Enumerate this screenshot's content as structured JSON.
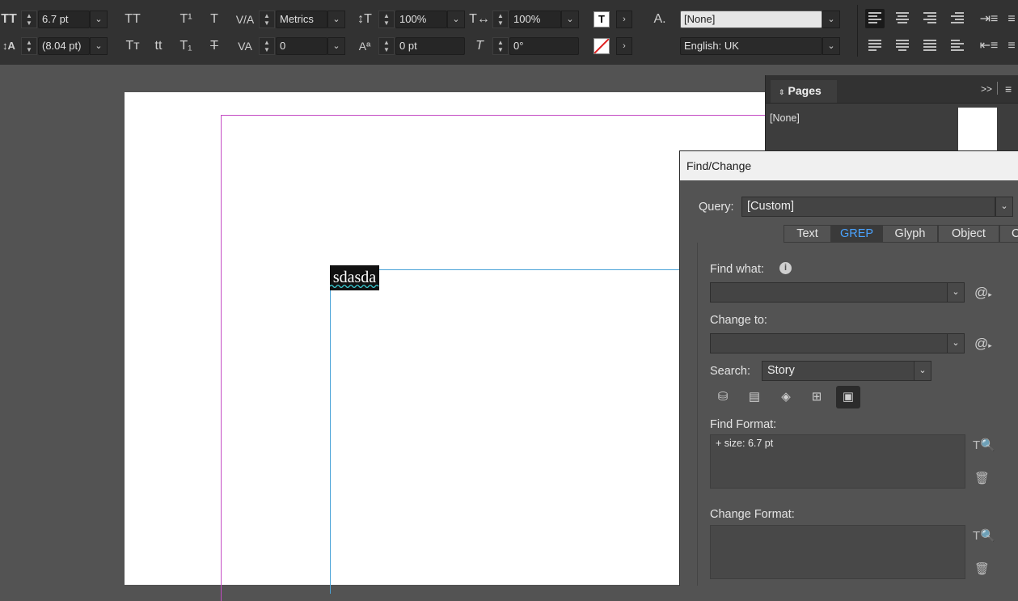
{
  "control_bar": {
    "font_size": "6.7 pt",
    "leading": "(8.04 pt)",
    "kerning": "Metrics",
    "tracking": "0",
    "vertical_scale": "100%",
    "horizontal_scale": "100%",
    "baseline_shift": "0 pt",
    "skew": "0°",
    "character_style": "[None]",
    "language": "English: UK"
  },
  "document": {
    "selected_text": "sdasda"
  },
  "pages_panel": {
    "title": "Pages",
    "master": "[None]",
    "menu_expand": ">>"
  },
  "find_change": {
    "title": "Find/Change",
    "query_label": "Query:",
    "query_value": "[Custom]",
    "tabs": [
      "Text",
      "GREP",
      "Glyph",
      "Object",
      "C"
    ],
    "active_tab": "GREP",
    "find_what_label": "Find what:",
    "find_what_value": "",
    "change_to_label": "Change to:",
    "change_to_value": "",
    "search_label": "Search:",
    "search_value": "Story",
    "find_format_label": "Find Format:",
    "find_format_value": "+ size: 6.7 pt",
    "change_format_label": "Change Format:",
    "change_format_value": ""
  },
  "colors": {
    "panel_bg": "#535353",
    "control_bar_bg": "#323232",
    "active_tab_text": "#4aa3ff",
    "margin_guide": "#c44bc4",
    "frame_edge": "#4aa3d8"
  }
}
